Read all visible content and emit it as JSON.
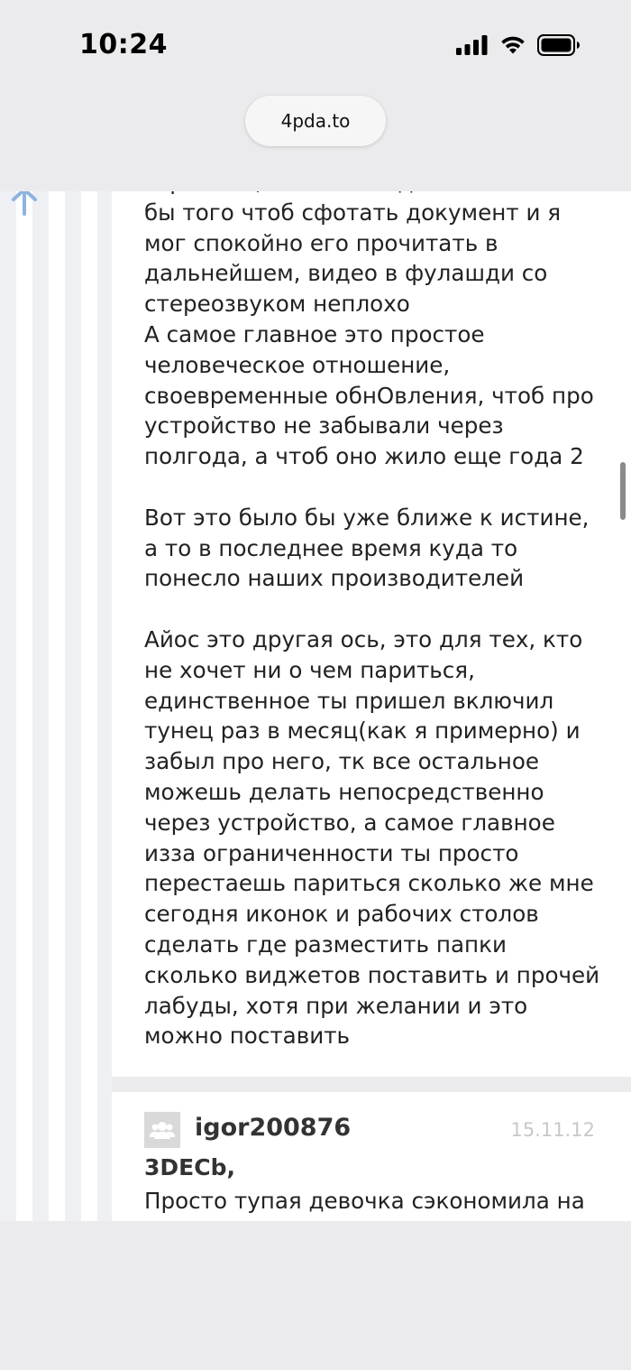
{
  "status_bar": {
    "time": "10:24",
    "icons": [
      "signal-icon",
      "wifi-icon",
      "battery-icon"
    ]
  },
  "browser": {
    "url": "4pda.to"
  },
  "post1": {
    "text": "зеркалом, лично мне достаточно было\nбы того чтоб сфотать документ и я\nмог спокойно его прочитать в\nдальнейшем, видео в фулашди со\nстереозвуком неплохо\nА самое главное это простое\nчеловеческое отношение,\nсвоевременные обнОвления, чтоб про\nустройство не забывали через\nполгода, а чтоб оно жило еще года 2\n\nВот это было бы уже ближе к истине,\nа то в последнее время куда то\nпонесло наших производителей\n\nАйос это другая ось, это для тех, кто\nне хочет ни о чем париться,\nединственное ты пришел включил\nтунец раз в месяц(как я примерно) и\nзабыл про него, тк все остальное\nможешь делать непосредственно\nчерез устройство, а самое главное\nизза ограниченности ты просто\nперестаешь париться сколько же мне\nсегодня иконок и рабочих столов\nсделать где разместить папки\nсколько виджетов поставить и прочей\nлабуды, хотя при желании и это\nможно поставить"
  },
  "post2": {
    "author": "igor200876",
    "date": "15.11.12",
    "quoted_user": "3DECb,",
    "text": "Просто тупая девочка сэкономила на"
  },
  "colors": {
    "accent_arrow": "#8fb3dd",
    "lane": "#eef0f4",
    "text": "#222222",
    "date": "#c8c8c8"
  }
}
